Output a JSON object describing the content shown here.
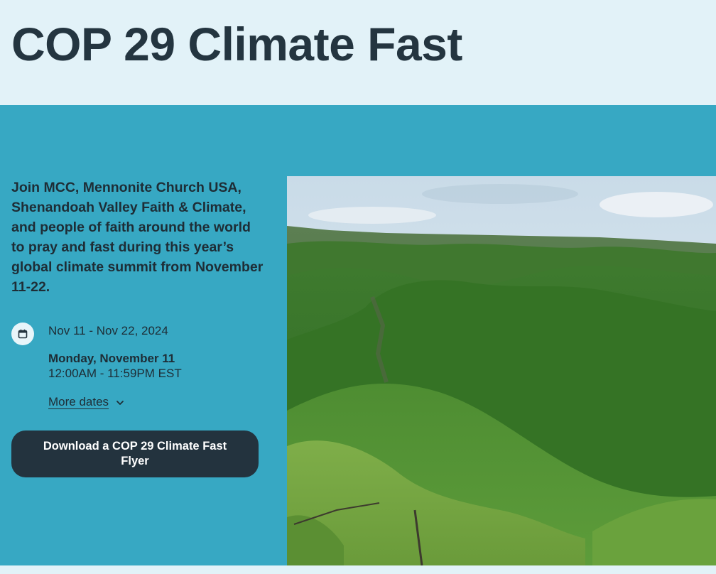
{
  "page": {
    "title": "COP 29 Climate Fast"
  },
  "event": {
    "description": "Join MCC, Mennonite Church USA, Shenandoah Valley Faith & Climate, and people of faith around the world to pray and fast during this year’s global climate summit from November 11-22.",
    "date_range": "Nov 11 - Nov 22, 2024",
    "first_day": "Monday, November 11",
    "time": "12:00AM - 11:59PM EST",
    "more_dates_label": "More dates",
    "download_label": "Download a COP 29 Climate Fast Flyer",
    "icons": {
      "calendar": "calendar-icon",
      "more_dates": "chevron-down-icon"
    }
  },
  "colors": {
    "header_bg": "#e2f2f8",
    "band_bg": "#37a8c3",
    "button_bg": "#23333e",
    "text": "#1e2d36"
  }
}
